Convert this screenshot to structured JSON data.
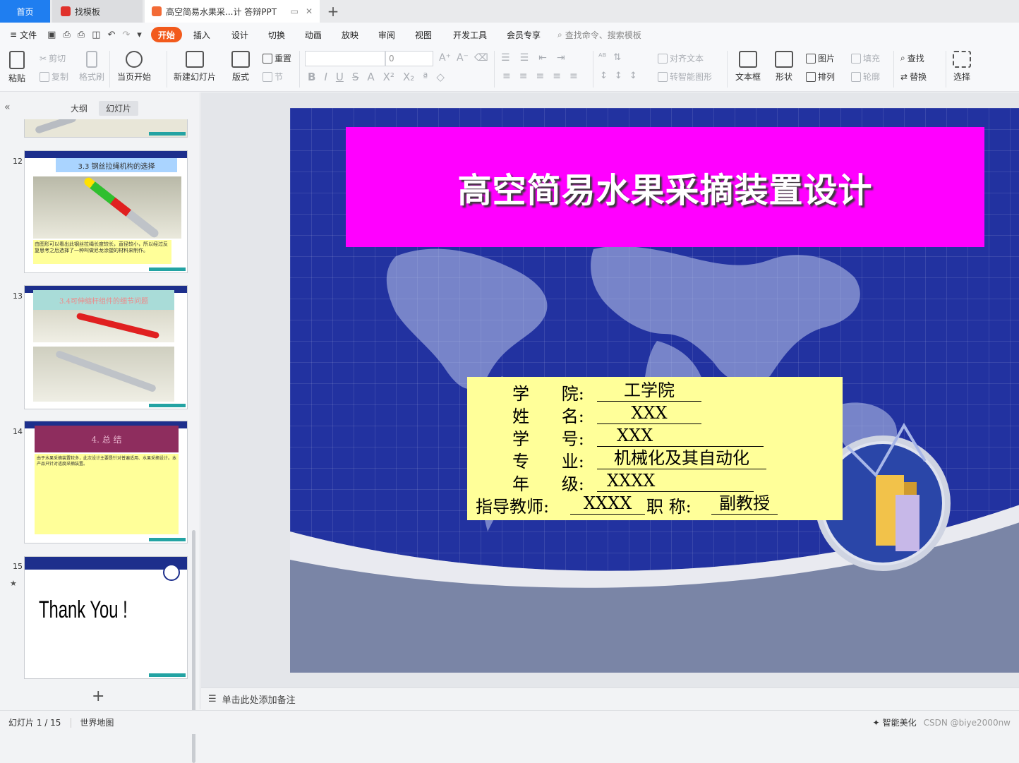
{
  "tabs": {
    "home": "首页",
    "templates": "找模板",
    "document": "高空简易水果采...计 答辩PPT"
  },
  "menu": {
    "file": "文件",
    "items": [
      "开始",
      "插入",
      "设计",
      "切换",
      "动画",
      "放映",
      "审阅",
      "视图",
      "开发工具",
      "会员专享"
    ],
    "search_placeholder": "查找命令、搜索模板"
  },
  "ribbon": {
    "paste": "粘贴",
    "cut": "剪切",
    "copy": "复制",
    "format_painter": "格式刷",
    "play_from_current": "当页开始",
    "new_slide": "新建幻灯片",
    "layout": "版式",
    "reset": "重置",
    "section": "节",
    "font_size": "0",
    "align_text": "对齐文本",
    "convert_smartart": "转智能图形",
    "textbox": "文本框",
    "shape": "形状",
    "picture": "图片",
    "arrange": "排列",
    "fill": "填充",
    "outline": "轮廓",
    "find": "查找",
    "replace": "替换",
    "select": "选择"
  },
  "left_panel": {
    "tab_outline": "大纲",
    "tab_slides": "幻灯片",
    "thumbs": [
      {
        "num": "12",
        "title": "3.3  钢丝拉绳机构的选择",
        "text": "由图形可以看出此钢丝拉绳长度较长，直径较小，所以经过反复思考之后选择了一种叫做尼龙涂塑的材料来制作。"
      },
      {
        "num": "13",
        "title": "3.4可伸缩杆组件的细节问题"
      },
      {
        "num": "14",
        "title": "4. 总 结",
        "text": "由于水果采摘装置较多，此次设计主要是针对普遍适用、水果采摘设计。本产品只针对适度采摘装置。"
      },
      {
        "num": "15",
        "text": "Thank You !"
      }
    ]
  },
  "slide": {
    "title": "高空简易水果采摘装置设计",
    "rows": [
      {
        "label": "学      院:",
        "value": "工学院"
      },
      {
        "label": "姓      名:",
        "value": "XXX"
      },
      {
        "label": "学      号:",
        "value": "XXX"
      },
      {
        "label": "专      业:",
        "value": "机械化及其自动化"
      },
      {
        "label": "年      级:",
        "value": "XXXX"
      }
    ],
    "advisor_label": "指导教师:",
    "advisor_value": "XXXX",
    "rank_label": "职  称:",
    "rank_value": "副教授"
  },
  "notes": {
    "placeholder": "单击此处添加备注"
  },
  "status": {
    "slide_counter": "幻灯片 1 / 15",
    "theme": "世界地图",
    "smart_beautify": "智能美化",
    "watermark": "CSDN @biye2000nw"
  },
  "colors": {
    "accent": "#f25a1c",
    "title_box": "#ff00ff",
    "info_box": "#ffff99",
    "slide_bg": "#2232a0"
  }
}
